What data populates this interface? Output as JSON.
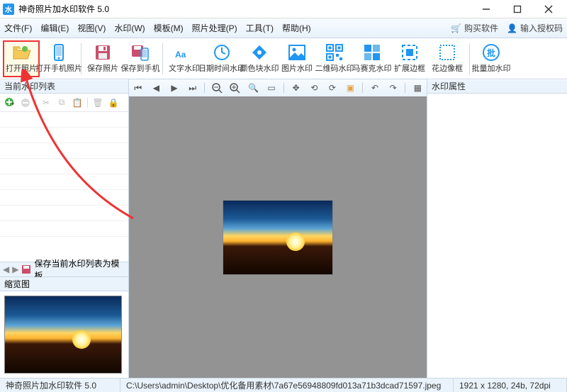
{
  "title": "神奇照片加水印软件 5.0",
  "menu": [
    "文件(F)",
    "编辑(E)",
    "视图(V)",
    "水印(W)",
    "模板(M)",
    "照片处理(P)",
    "工具(T)",
    "帮助(H)"
  ],
  "menu_right": {
    "buy": "购买软件",
    "auth": "输入授权码"
  },
  "toolbar": [
    {
      "id": "open",
      "label": "打开照片"
    },
    {
      "id": "open-phone",
      "label": "打开手机照片"
    },
    {
      "id": "save",
      "label": "保存照片"
    },
    {
      "id": "save-phone",
      "label": "保存到手机"
    },
    {
      "id": "text-wm",
      "label": "文字水印"
    },
    {
      "id": "date-wm",
      "label": "日期时间水印"
    },
    {
      "id": "color-wm",
      "label": "颜色块水印"
    },
    {
      "id": "image-wm",
      "label": "图片水印"
    },
    {
      "id": "qr-wm",
      "label": "二维码水印"
    },
    {
      "id": "mosaic-wm",
      "label": "马赛克水印"
    },
    {
      "id": "extend",
      "label": "扩展边框"
    },
    {
      "id": "lace",
      "label": "花边像框"
    },
    {
      "id": "batch",
      "label": "批量加水印"
    }
  ],
  "sidebar": {
    "list_header": "当前水印列表",
    "save_template": "保存当前水印列表为模板",
    "thumb_header": "缩览图"
  },
  "right": {
    "header": "水印属性"
  },
  "status": {
    "app": "神奇照片加水印软件 5.0",
    "path": "C:\\Users\\admin\\Desktop\\优化备用素材\\7a67e56948809fd013a71b3dcad71597.jpeg",
    "info": "1921 x 1280, 24b, 72dpi"
  }
}
